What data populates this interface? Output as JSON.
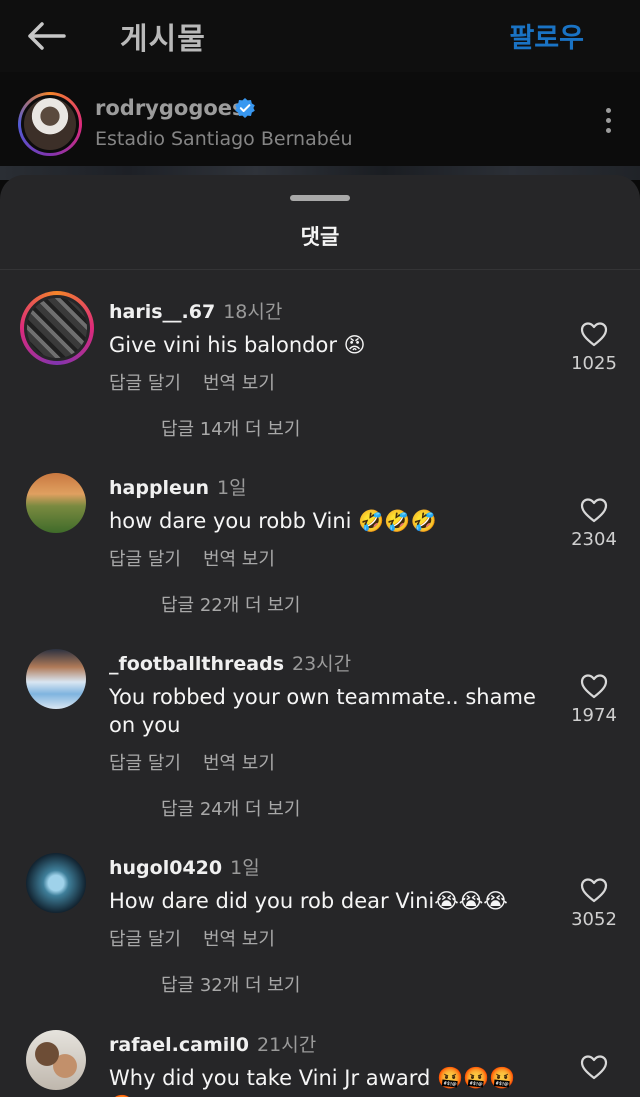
{
  "header": {
    "title": "게시물",
    "follow_label": "팔로우"
  },
  "post": {
    "username": "rodrygogoes",
    "location": "Estadio Santiago Bernabéu"
  },
  "comments_sheet": {
    "title": "댓글"
  },
  "comments": [
    {
      "username": "haris__.67",
      "time": "18시간",
      "text": "Give vini his balondor 😡",
      "reply": "답글 달기",
      "translate": "번역 보기",
      "more_replies": "답글 14개 더 보기",
      "likes": "1025"
    },
    {
      "username": "happleun",
      "time": "1일",
      "text": "how dare you robb Vini 🤣🤣🤣",
      "reply": "답글 달기",
      "translate": "번역 보기",
      "more_replies": "답글 22개 더 보기",
      "likes": "2304"
    },
    {
      "username": "_footballthreads",
      "time": "23시간",
      "text": "You robbed your own teammate.. shame on you",
      "reply": "답글 달기",
      "translate": "번역 보기",
      "more_replies": "답글 24개 더 보기",
      "likes": "1974"
    },
    {
      "username": "hugol0420",
      "time": "1일",
      "text": "How dare did you rob dear Vini😭😭😭",
      "reply": "답글 달기",
      "translate": "번역 보기",
      "more_replies": "답글 32개 더 보기",
      "likes": "3052"
    },
    {
      "username": "rafael.camil0",
      "time": "21시간",
      "text": "Why did you take Vini Jr award 🤬🤬🤬🤬"
    }
  ],
  "icons": [
    "back-arrow-icon",
    "verified-icon",
    "more-icon",
    "heart-icon"
  ],
  "colors": {
    "accent": "#1a73c4",
    "sheet": "#262628",
    "verified": "#3897f0"
  }
}
